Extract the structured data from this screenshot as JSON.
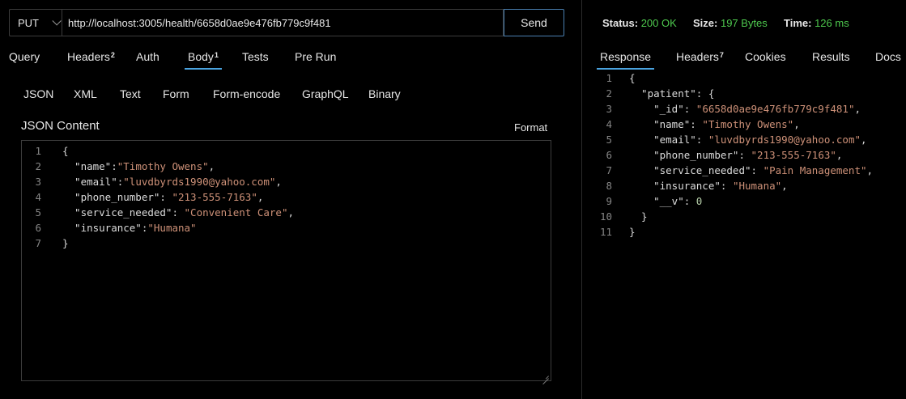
{
  "request": {
    "method": "PUT",
    "url": "http://localhost:3005/health/6658d0ae9e476fb779c9f481",
    "send_label": "Send",
    "tabs": [
      {
        "label": "Query",
        "badge": ""
      },
      {
        "label": "Headers",
        "badge": "2"
      },
      {
        "label": "Auth",
        "badge": ""
      },
      {
        "label": "Body",
        "badge": "1"
      },
      {
        "label": "Tests",
        "badge": ""
      },
      {
        "label": "Pre Run",
        "badge": ""
      }
    ],
    "active_tab": "Body",
    "body_types": [
      "JSON",
      "XML",
      "Text",
      "Form",
      "Form-encode",
      "GraphQL",
      "Binary"
    ],
    "content_title": "JSON Content",
    "format_label": "Format",
    "editor_lines": [
      {
        "num": "1",
        "parts": [
          [
            "p",
            "{"
          ]
        ]
      },
      {
        "num": "2",
        "parts": [
          [
            "k",
            "  \"name\""
          ],
          [
            "p",
            ":"
          ],
          [
            "s",
            "\"Timothy Owens\""
          ],
          [
            "p",
            ","
          ]
        ]
      },
      {
        "num": "3",
        "parts": [
          [
            "k",
            "  \"email\""
          ],
          [
            "p",
            ":"
          ],
          [
            "s",
            "\"luvdbyrds1990@yahoo.com\""
          ],
          [
            "p",
            ","
          ]
        ]
      },
      {
        "num": "4",
        "parts": [
          [
            "k",
            "  \"phone_number\""
          ],
          [
            "p",
            ": "
          ],
          [
            "s",
            "\"213-555-7163\""
          ],
          [
            "p",
            ","
          ]
        ]
      },
      {
        "num": "5",
        "parts": [
          [
            "k",
            "  \"service_needed\""
          ],
          [
            "p",
            ": "
          ],
          [
            "s",
            "\"Convenient Care\""
          ],
          [
            "p",
            ","
          ]
        ]
      },
      {
        "num": "6",
        "parts": [
          [
            "k",
            "  \"insurance\""
          ],
          [
            "p",
            ":"
          ],
          [
            "s",
            "\"Humana\""
          ]
        ]
      },
      {
        "num": "7",
        "parts": [
          [
            "p",
            "}"
          ]
        ]
      }
    ]
  },
  "response": {
    "status_label": "Status:",
    "status_value": "200 OK",
    "size_label": "Size:",
    "size_value": "197 Bytes",
    "time_label": "Time:",
    "time_value": "126 ms",
    "tabs": [
      {
        "label": "Response",
        "badge": ""
      },
      {
        "label": "Headers",
        "badge": "7"
      },
      {
        "label": "Cookies",
        "badge": ""
      },
      {
        "label": "Results",
        "badge": ""
      },
      {
        "label": "Docs",
        "badge": ""
      }
    ],
    "active_tab": "Response",
    "lines": [
      {
        "num": "1",
        "parts": [
          [
            "p",
            "{"
          ]
        ]
      },
      {
        "num": "2",
        "parts": [
          [
            "k",
            "  \"patient\""
          ],
          [
            "p",
            ": {"
          ]
        ]
      },
      {
        "num": "3",
        "parts": [
          [
            "k",
            "    \"_id\""
          ],
          [
            "p",
            ": "
          ],
          [
            "s",
            "\"6658d0ae9e476fb779c9f481\""
          ],
          [
            "p",
            ","
          ]
        ]
      },
      {
        "num": "4",
        "parts": [
          [
            "k",
            "    \"name\""
          ],
          [
            "p",
            ": "
          ],
          [
            "s",
            "\"Timothy Owens\""
          ],
          [
            "p",
            ","
          ]
        ]
      },
      {
        "num": "5",
        "parts": [
          [
            "k",
            "    \"email\""
          ],
          [
            "p",
            ": "
          ],
          [
            "s",
            "\"luvdbyrds1990@yahoo.com\""
          ],
          [
            "p",
            ","
          ]
        ]
      },
      {
        "num": "6",
        "parts": [
          [
            "k",
            "    \"phone_number\""
          ],
          [
            "p",
            ": "
          ],
          [
            "s",
            "\"213-555-7163\""
          ],
          [
            "p",
            ","
          ]
        ]
      },
      {
        "num": "7",
        "parts": [
          [
            "k",
            "    \"service_needed\""
          ],
          [
            "p",
            ": "
          ],
          [
            "s",
            "\"Pain Management\""
          ],
          [
            "p",
            ","
          ]
        ]
      },
      {
        "num": "8",
        "parts": [
          [
            "k",
            "    \"insurance\""
          ],
          [
            "p",
            ": "
          ],
          [
            "s",
            "\"Humana\""
          ],
          [
            "p",
            ","
          ]
        ]
      },
      {
        "num": "9",
        "parts": [
          [
            "k",
            "    \"__v\""
          ],
          [
            "p",
            ": "
          ],
          [
            "n",
            "0"
          ]
        ]
      },
      {
        "num": "10",
        "parts": [
          [
            "p",
            "  }"
          ]
        ]
      },
      {
        "num": "11",
        "parts": [
          [
            "p",
            "}"
          ]
        ]
      }
    ]
  },
  "colors": {
    "status_ok": "#4ec94e",
    "string": "#ce9178",
    "active_tab_underline": "#4aa3df",
    "send_border": "#4a7fb0"
  }
}
